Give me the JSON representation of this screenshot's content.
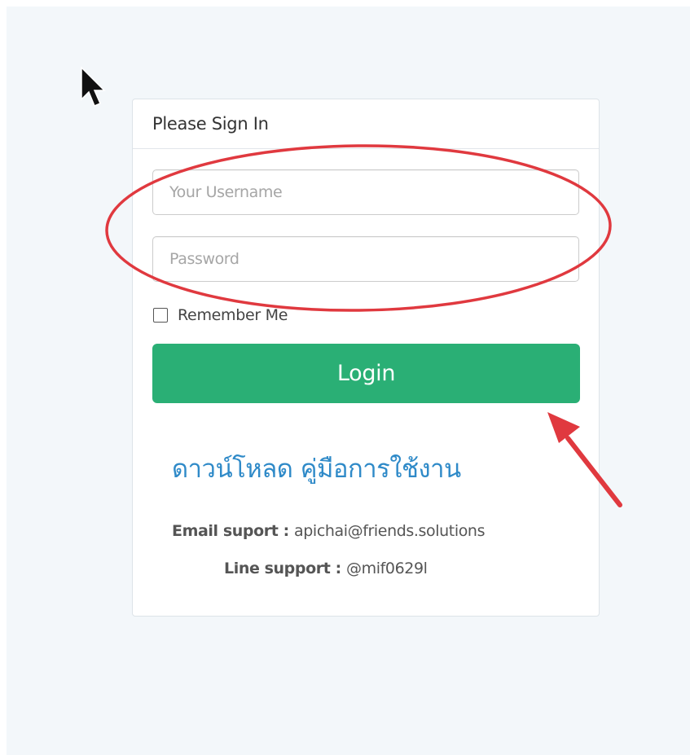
{
  "panel": {
    "title": "Please Sign In"
  },
  "form": {
    "username_placeholder": "Your Username",
    "password_placeholder": "Password",
    "remember_label": "Remember Me",
    "login_label": "Login"
  },
  "help": {
    "download_link": "ดาวน์โหลด คู่มือการใช้งาน",
    "email_label": "Email suport",
    "email_value": "apichai@friends.solutions",
    "line_label": "Line support",
    "line_value": "@mif0629l"
  },
  "icons": {
    "cursor": "mouse-pointer-icon",
    "arrow": "annotation-arrow-icon",
    "ellipse": "annotation-ellipse"
  },
  "colors": {
    "background": "#f3f7fa",
    "login_button": "#2aaf75",
    "link": "#2f8ac8",
    "annotation": "#e0393f"
  }
}
